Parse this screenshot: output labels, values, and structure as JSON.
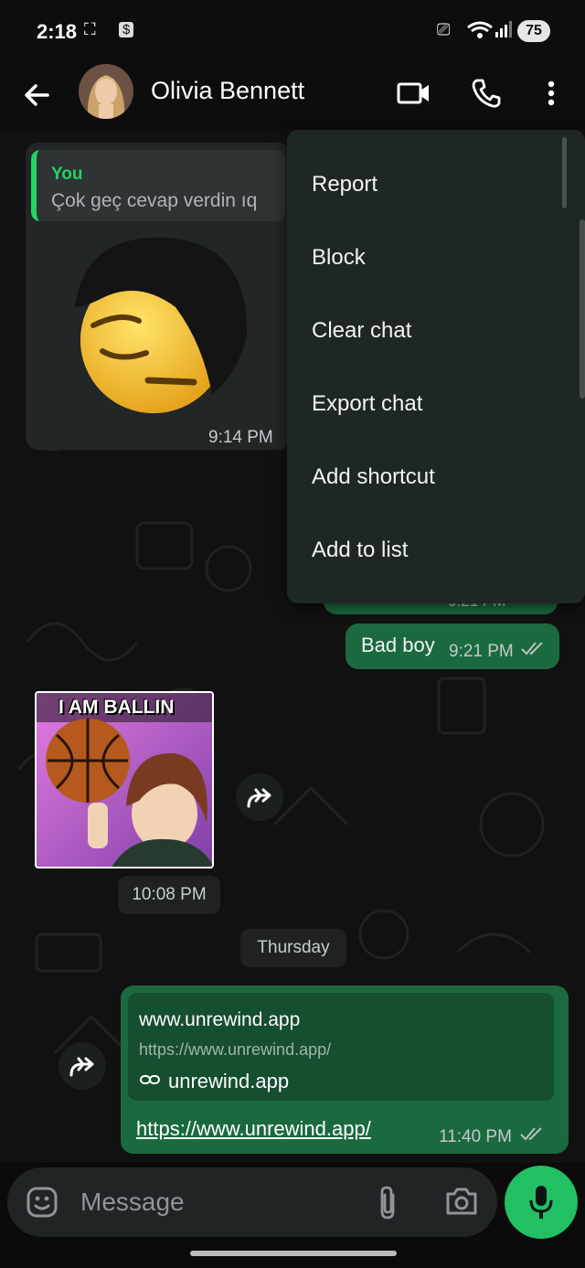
{
  "status_bar": {
    "time": "2:18",
    "battery": "75"
  },
  "header": {
    "contact_name": "Olivia Bennett"
  },
  "menu": {
    "items": [
      "Report",
      "Block",
      "Clear chat",
      "Export chat",
      "Add shortcut",
      "Add to list"
    ]
  },
  "messages": {
    "sticker1": {
      "quote_author": "You",
      "quote_text": "Çok geç cevap verdin ıq",
      "time": "9:14 PM"
    },
    "hidden_out": {
      "time": "9:21 PM"
    },
    "bad_boy": {
      "text": "Bad boy",
      "time": "9:21 PM"
    },
    "sticker2": {
      "caption": "I AM BALLIN",
      "time": "10:08 PM"
    },
    "day_divider": "Thursday",
    "link_msg": {
      "preview_title": "www.unrewind.app",
      "preview_url": "https://www.unrewind.app/",
      "preview_domain": "unrewind.app",
      "text": "https://www.unrewind.app/",
      "time": "11:40 PM"
    }
  },
  "composer": {
    "placeholder": "Message"
  },
  "colors": {
    "accent": "#25d366",
    "outgoing_bubble": "#1b6a3f",
    "incoming_bubble": "#232626",
    "menu_bg": "#1f2626"
  },
  "icons": [
    "arrow-back-icon",
    "video-call-icon",
    "phone-icon",
    "more-vert-icon",
    "forward-icon",
    "emoji-icon",
    "attach-icon",
    "camera-icon",
    "mic-icon",
    "link-icon",
    "double-check-icon"
  ]
}
